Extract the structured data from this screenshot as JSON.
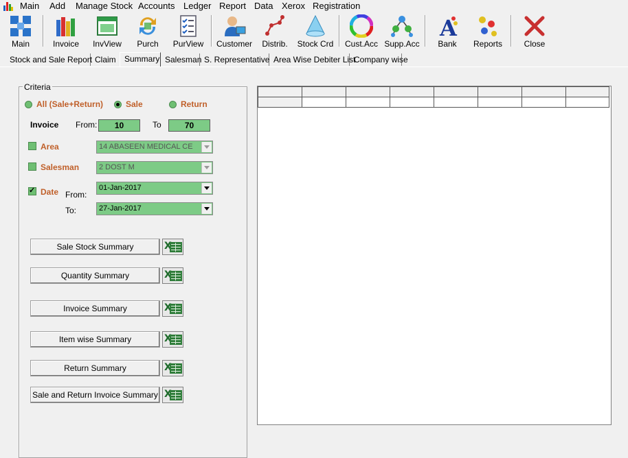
{
  "menu": [
    "Main",
    "Add",
    "Manage Stock",
    "Accounts",
    "Ledger",
    "Report",
    "Data",
    "Xerox",
    "Registration"
  ],
  "toolbar": [
    {
      "label": "Main",
      "icon": "grid-icon"
    },
    {
      "label": "Invoice",
      "icon": "books-icon"
    },
    {
      "label": "InvView",
      "icon": "window-icon"
    },
    {
      "label": "Purch",
      "icon": "refresh-arrows-icon"
    },
    {
      "label": "PurView",
      "icon": "checklist-icon"
    },
    {
      "label": "Customer",
      "icon": "user-icon"
    },
    {
      "label": "Distrib.",
      "icon": "network-line-icon"
    },
    {
      "label": "Stock Crd",
      "icon": "cone-icon"
    },
    {
      "label": "Cust.Acc",
      "icon": "color-wheel-icon"
    },
    {
      "label": "Supp.Acc",
      "icon": "tree-network-icon"
    },
    {
      "label": "Bank",
      "icon": "letter-a-icon"
    },
    {
      "label": "Reports",
      "icon": "dots-icon"
    },
    {
      "label": "Close",
      "icon": "close-icon"
    }
  ],
  "tabs": [
    "Stock and Sale Report",
    "Claim",
    "Summary",
    "Salesman",
    "S. Representative",
    "Area Wise Debiter List",
    "Company wise"
  ],
  "active_tab": "Summary",
  "criteria": {
    "title": "Criteria",
    "radios": {
      "all": "All (Sale+Return)",
      "sale": "Sale",
      "return": "Return",
      "selected": "Sale"
    },
    "invoice": {
      "label": "Invoice",
      "from_label": "From:",
      "from": "10",
      "to_label": "To",
      "to": "70"
    },
    "area": {
      "label": "Area",
      "checked": false,
      "value": "14      ABASEEN MEDICAL CE"
    },
    "salesman": {
      "label": "Salesman",
      "checked": false,
      "value": "2       DOST M"
    },
    "date": {
      "label": "Date",
      "checked": true,
      "from_label": "From:",
      "from": "01-Jan-2017",
      "to_label": "To:",
      "to": "27-Jan-2017"
    }
  },
  "buttons": [
    "Sale Stock Summary",
    "Quantity Summary",
    "Invoice Summary",
    "Item wise Summary",
    "Return Summary",
    "Sale and Return Invoice Summary"
  ]
}
